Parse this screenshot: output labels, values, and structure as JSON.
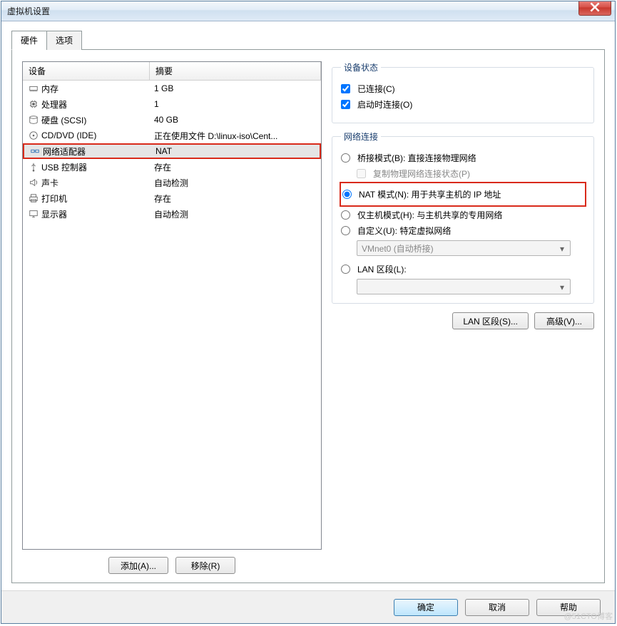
{
  "window": {
    "title": "虚拟机设置"
  },
  "tabs": {
    "hardware": "硬件",
    "options": "选项"
  },
  "columns": {
    "device": "设备",
    "summary": "摘要"
  },
  "devices": [
    {
      "icon": "memory-icon",
      "name": "内存",
      "summary": "1 GB"
    },
    {
      "icon": "cpu-icon",
      "name": "处理器",
      "summary": "1"
    },
    {
      "icon": "disk-icon",
      "name": "硬盘 (SCSI)",
      "summary": "40 GB"
    },
    {
      "icon": "cd-icon",
      "name": "CD/DVD (IDE)",
      "summary": "正在使用文件 D:\\linux-iso\\Cent..."
    },
    {
      "icon": "net-icon",
      "name": "网络适配器",
      "summary": "NAT"
    },
    {
      "icon": "usb-icon",
      "name": "USB 控制器",
      "summary": "存在"
    },
    {
      "icon": "sound-icon",
      "name": "声卡",
      "summary": "自动检测"
    },
    {
      "icon": "printer-icon",
      "name": "打印机",
      "summary": "存在"
    },
    {
      "icon": "display-icon",
      "name": "显示器",
      "summary": "自动检测"
    }
  ],
  "leftButtons": {
    "add": "添加(A)...",
    "remove": "移除(R)"
  },
  "status": {
    "legend": "设备状态",
    "connected": "已连接(C)",
    "connectAtStart": "启动时连接(O)"
  },
  "network": {
    "legend": "网络连接",
    "bridged": "桥接模式(B): 直接连接物理网络",
    "replicate": "复制物理网络连接状态(P)",
    "nat": "NAT 模式(N): 用于共享主机的 IP 地址",
    "hostonly": "仅主机模式(H): 与主机共享的专用网络",
    "custom": "自定义(U): 特定虚拟网络",
    "customSelect": "VMnet0 (自动桥接)",
    "lan": "LAN 区段(L):",
    "lanBtn": "LAN 区段(S)...",
    "advBtn": "高级(V)..."
  },
  "footer": {
    "ok": "确定",
    "cancel": "取消",
    "help": "帮助"
  },
  "watermark": "@51CTO博客"
}
